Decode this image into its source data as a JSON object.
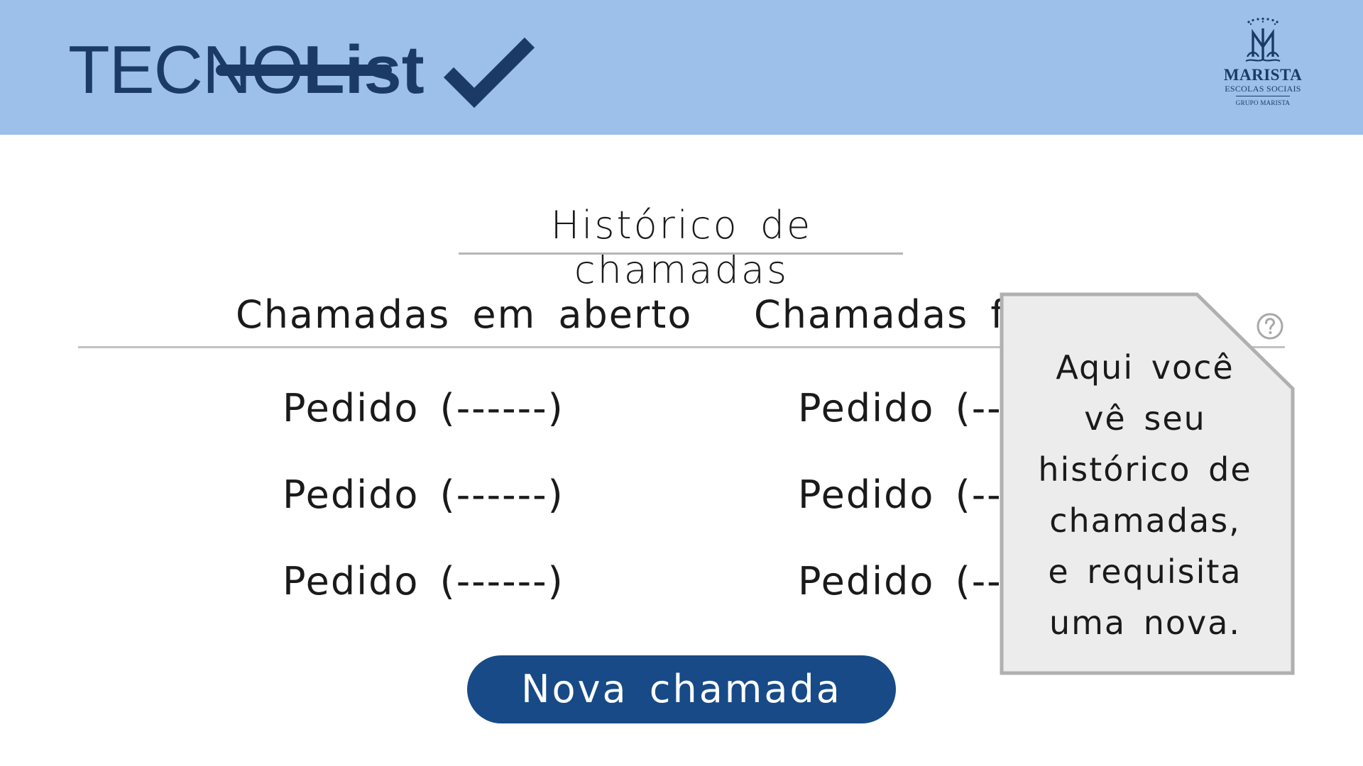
{
  "header": {
    "brand_prefix": "TECNO",
    "brand_suffix": "List",
    "logo_title": "MARISTA",
    "logo_subtitle": "ESCOLAS SOCIAIS",
    "logo_group": "GRUPO MARISTA"
  },
  "main": {
    "title": "Histórico de chamadas",
    "columns": [
      {
        "heading": "Chamadas em aberto",
        "items": [
          "Pedido (------)",
          "Pedido (------)",
          "Pedido (------)"
        ]
      },
      {
        "heading": "Chamadas fechadas",
        "items": [
          "Pedido (------)",
          "Pedido (------)",
          "Pedido (------)"
        ]
      }
    ],
    "new_call_label": "Nova chamada"
  },
  "note": {
    "lines": [
      "Aqui você",
      "vê seu",
      "histórico de",
      "chamadas,",
      "e requisita",
      "uma nova."
    ]
  },
  "icons": {
    "brand": "checkmark-icon",
    "help": "question-mark-icon",
    "logo": "marista-monogram-icon"
  },
  "colors": {
    "header_bg": "#9cc0ea",
    "brand": "#1b3a66",
    "button": "#174a87",
    "note_bg": "#ececec",
    "note_border": "#b0b0b0"
  }
}
